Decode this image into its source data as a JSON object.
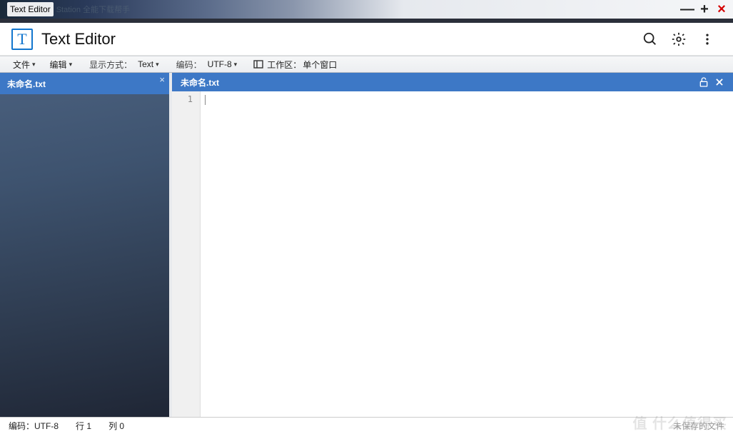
{
  "os": {
    "title": "Text Editor",
    "ghost": "Station 全能下载帮手",
    "minimize": "—",
    "maximize": "+",
    "close": "×"
  },
  "header": {
    "icon_letter": "T",
    "title": "Text Editor"
  },
  "menubar": {
    "file": "文件",
    "edit": "编辑",
    "display_label": "显示方式：",
    "display_value": "Text",
    "encoding_label": "编码：",
    "encoding_value": "UTF-8",
    "workspace_label": "工作区：",
    "workspace_value": "单个窗口"
  },
  "sidebar": {
    "tab_name": "未命名.txt"
  },
  "editor": {
    "tab_name": "未命名.txt",
    "line_numbers": [
      "1"
    ],
    "content": ""
  },
  "statusbar": {
    "encoding_label": "编码：",
    "encoding_value": "UTF-8",
    "line_label": "行",
    "line_value": "1",
    "col_label": "列",
    "col_value": "0",
    "unsaved": "未保存的文件"
  },
  "icons": {
    "search": "search-icon",
    "gear": "gear-icon",
    "more": "more-vert-icon",
    "workspace": "workspace-icon",
    "unlock": "unlock-icon",
    "close_tab": "close-icon"
  },
  "watermark": "值 什么值得买"
}
